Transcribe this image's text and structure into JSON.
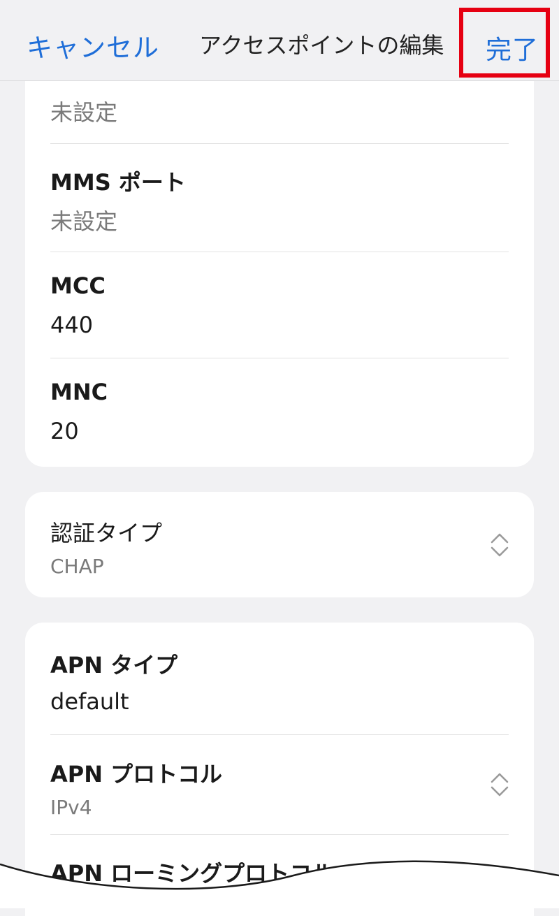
{
  "header": {
    "cancel_label": "キャンセル",
    "title": "アクセスポイントの編集",
    "done_label": "完了"
  },
  "card1": {
    "top_value": "未設定",
    "rows": [
      {
        "label": "MMS ポート",
        "value": "未設定"
      },
      {
        "label": "MCC",
        "value": "440"
      },
      {
        "label": "MNC",
        "value": "20"
      }
    ]
  },
  "card2": {
    "label": "認証タイプ",
    "value": "CHAP"
  },
  "card3": {
    "rows": [
      {
        "label": "APN タイプ",
        "value": "default"
      },
      {
        "label": "APN プロトコル",
        "value": "IPv4"
      },
      {
        "label": "APN ローミングプロトコル",
        "value": ""
      }
    ]
  },
  "colors": {
    "accent": "#1f6ed8",
    "highlight_border": "#e60012",
    "background": "#f1f1f3",
    "card": "#ffffff",
    "muted_text": "#7a7a7a"
  },
  "icons": {
    "dropdown": "chevron-up-down-icon"
  }
}
